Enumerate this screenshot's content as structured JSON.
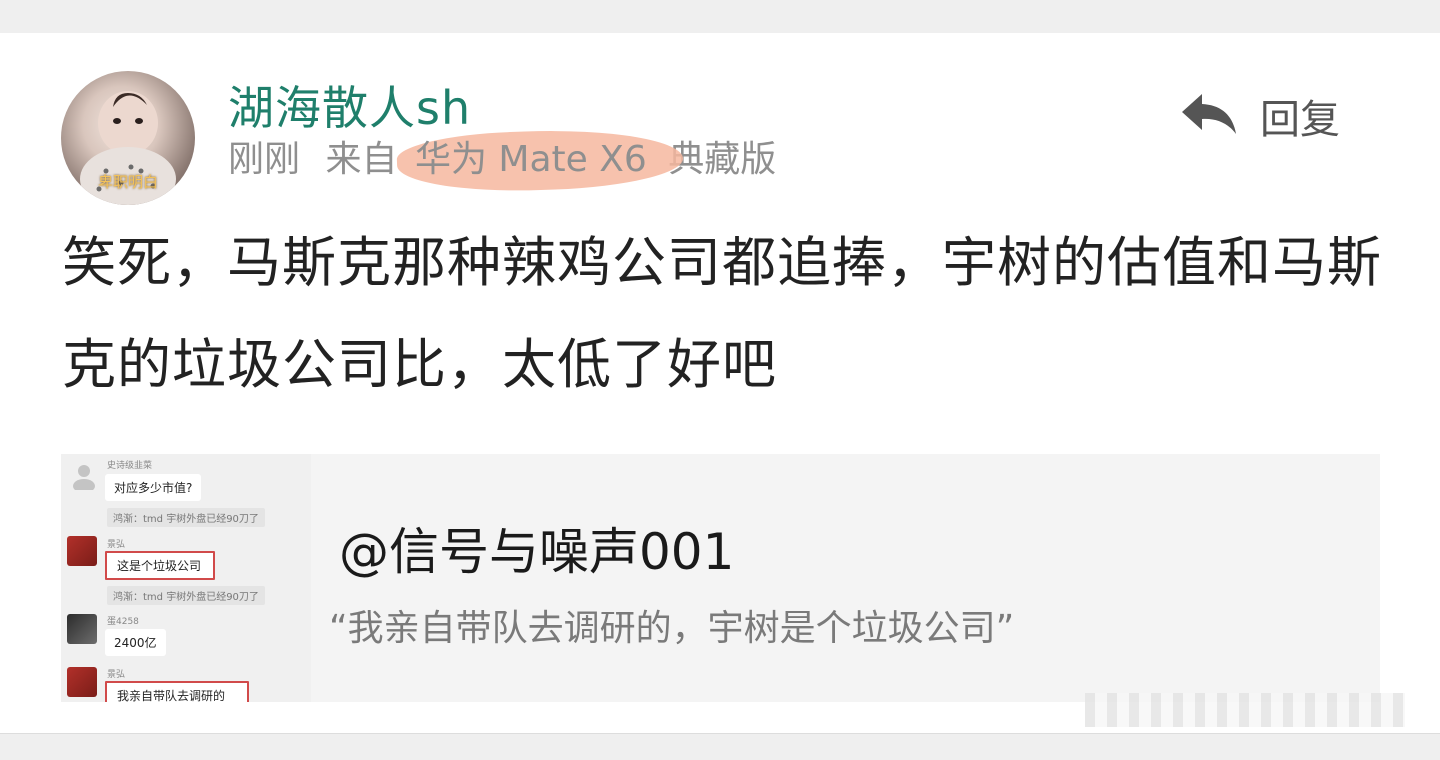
{
  "user": {
    "name": "湖海散人sh",
    "avatar_caption": "卑职明白"
  },
  "meta": {
    "time": "刚刚",
    "source_prefix": "来自",
    "device": "华为 Mate X6",
    "device_suffix": "典藏版"
  },
  "actions": {
    "reply_label": "回复",
    "reply_icon": "reply-arrow-icon"
  },
  "post": {
    "text": "笑死，马斯克那种辣鸡公司都追捧，宇树的估值和马斯克的垃圾公司比，太低了好吧"
  },
  "quote": {
    "mention": "@信号与噪声001",
    "text": "“我亲自带队去调研的，宇树是个垃圾公司”",
    "chat": {
      "messages": [
        {
          "sender": "史诗级韭菜",
          "text": "对应多少市值?"
        },
        {
          "system": "鸿渐：tmd 宇树外盘已经90刀了"
        },
        {
          "sender": "景弘",
          "text": "这是个垃圾公司"
        },
        {
          "system": "鸿渐：tmd 宇树外盘已经90刀了"
        },
        {
          "sender": "蛋4258",
          "text": "2400亿"
        },
        {
          "sender": "景弘",
          "text": "我亲自带队去调研的"
        }
      ]
    }
  },
  "colors": {
    "username": "#1f7f6b",
    "highlight": "#f6b79f",
    "chat_box_border": "#d14a4a"
  }
}
